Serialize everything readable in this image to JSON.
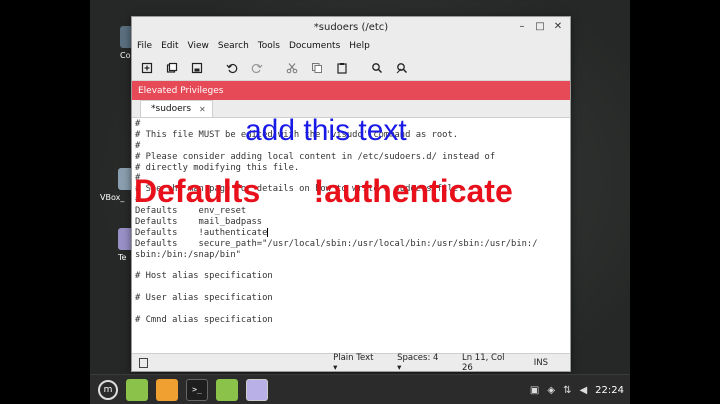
{
  "window": {
    "title": "*sudoers (/etc)",
    "controls": [
      "–",
      "□",
      "✕"
    ]
  },
  "menu": [
    "File",
    "Edit",
    "View",
    "Search",
    "Tools",
    "Documents",
    "Help"
  ],
  "toolbar_icons": [
    "new-doc-icon",
    "open-icon",
    "save-icon",
    "undo-icon",
    "redo-icon",
    "cut-icon",
    "copy-icon",
    "paste-icon",
    "search-icon",
    "replace-icon"
  ],
  "privileges_bar": "Elevated Privileges",
  "tab": {
    "label": "*sudoers",
    "close": "✕"
  },
  "editor_lines": [
    "#",
    "# This file MUST be edited with the 'visudo' command as root.",
    "#",
    "# Please consider adding local content in /etc/sudoers.d/ instead of",
    "# directly modifying this file.",
    "#",
    "# See the man page for details on how to write a sudoers file.",
    "#",
    "Defaults    env_reset",
    "Defaults    mail_badpass",
    "Defaults    !authenticate",
    "Defaults    secure_path=\"/usr/local/sbin:/usr/local/bin:/usr/sbin:/usr/bin:/",
    "sbin:/bin:/snap/bin\"",
    "",
    "# Host alias specification",
    "",
    "# User alias specification",
    "",
    "# Cmnd alias specification",
    ""
  ],
  "statusbar": {
    "syntax": "Plain Text ▾",
    "spaces": "Spaces: 4 ▾",
    "position": "Ln 11, Col 26",
    "mode": "INS"
  },
  "annotations": {
    "blue": "add this text",
    "red": "Defaults      !authenticate"
  },
  "desktop_icons": [
    {
      "label": "Co"
    },
    {
      "label": "VBox_"
    },
    {
      "label": "Te"
    }
  ],
  "taskbar": {
    "time": "22:24"
  },
  "colors": {
    "privileges": "#e64a57",
    "annotation_blue": "#1a1ae6",
    "annotation_red": "#e8101a"
  }
}
